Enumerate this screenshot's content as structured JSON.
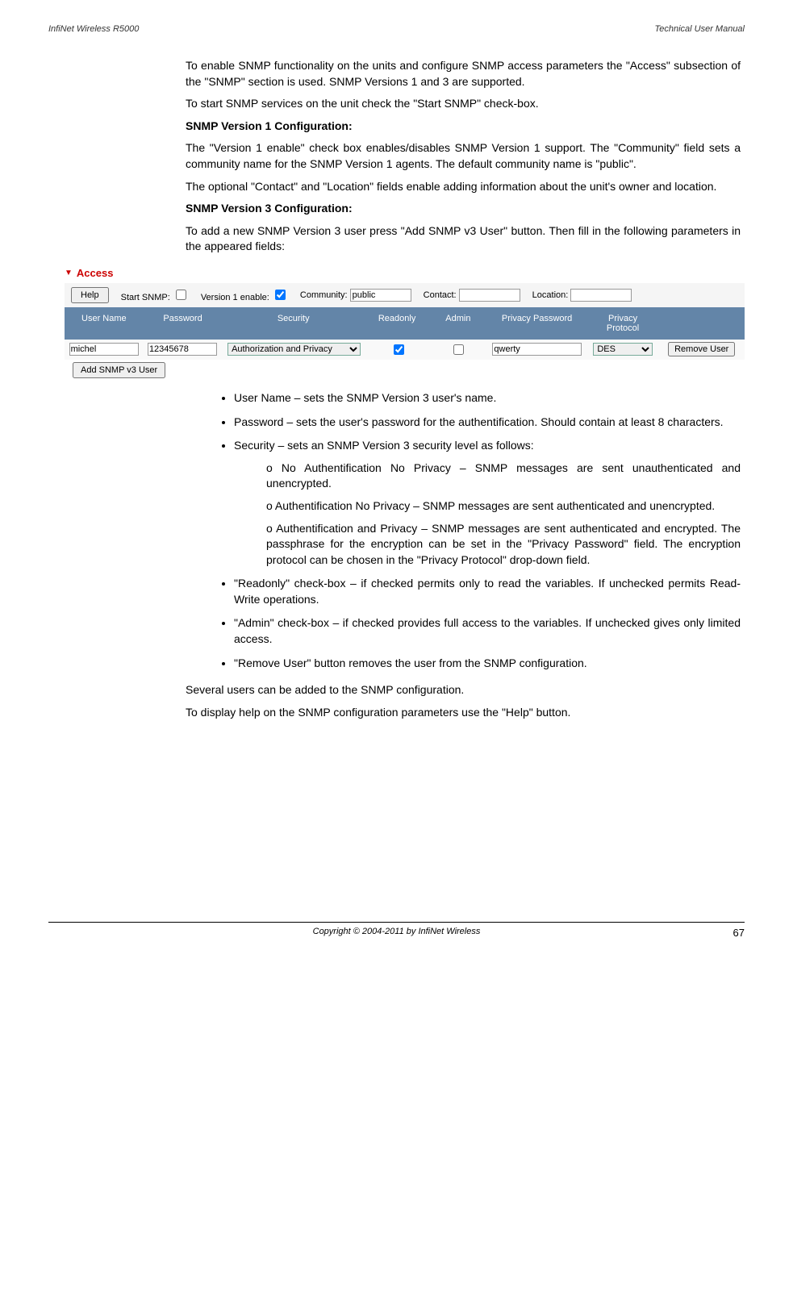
{
  "header": {
    "left": "InfiNet Wireless R5000",
    "right": "Technical User Manual"
  },
  "para1": "To enable SNMP functionality on the units and configure SNMP access parameters the \"Access\" subsection of the \"SNMP\" section is used. SNMP Versions 1 and 3 are supported.",
  "para2": "To start SNMP services on the unit check the \"Start SNMP\" check-box.",
  "heading1": "SNMP Version 1 Configuration:",
  "para3": "The \"Version 1 enable\" check box enables/disables SNMP Version 1 support. The \"Community\" field sets a community name for the SNMP Version 1 agents. The default community name is \"public\".",
  "para4": "The optional \"Contact\" and \"Location\" fields enable adding information about the unit's owner and location.",
  "heading2": "SNMP Version 3 Configuration:",
  "para5": "To add a new SNMP Version 3 user press \"Add SNMP v3 User\" button. Then fill in the following parameters in the appeared fields:",
  "screenshot": {
    "section_title": "Access",
    "help_button": "Help",
    "start_snmp_label": "Start SNMP:",
    "version1_label": "Version 1 enable:",
    "community_label": "Community:",
    "community_value": "public",
    "contact_label": "Contact:",
    "contact_value": "",
    "location_label": "Location:",
    "location_value": "",
    "columns": {
      "username": "User Name",
      "password": "Password",
      "security": "Security",
      "readonly": "Readonly",
      "admin": "Admin",
      "privpass": "Privacy Password",
      "privprot": "Privacy Protocol"
    },
    "row": {
      "username": "michel",
      "password": "12345678",
      "security": "Authorization and Privacy",
      "privpass": "qwerty",
      "privprot": "DES",
      "remove": "Remove User"
    },
    "add_button": "Add SNMP v3 User"
  },
  "bullets": {
    "b1": "User Name – sets the SNMP Version 3 user's name.",
    "b2": "Password – sets the user's password for the authentification. Should contain at least 8 characters.",
    "b3": "Security – sets an SNMP Version 3 security level as follows:",
    "b3_sub1": "No Authentification No Privacy – SNMP messages are sent unauthenticated and unencrypted.",
    "b3_sub2": "Authentification No Privacy – SNMP messages are sent authenticated and unencrypted.",
    "b3_sub3": "Authentification and Privacy – SNMP messages are sent authenticated and encrypted. The passphrase for the encryption can be set in the \"Privacy Password\" field. The encryption protocol can be chosen in the \"Privacy Protocol\" drop-down field.",
    "b4": "\"Readonly\" check-box – if checked permits only to read the variables. If unchecked permits Read-Write operations.",
    "b5": "\"Admin\" check-box – if checked provides full access to the variables. If unchecked gives only limited access.",
    "b6": "\"Remove User\" button removes the user from the SNMP configuration."
  },
  "para6": "Several users can be added to the SNMP configuration.",
  "para7": "To display help on the SNMP configuration parameters use the \"Help\" button.",
  "footer": {
    "copyright": "Copyright © 2004-2011 by InfiNet Wireless",
    "page": "67"
  }
}
